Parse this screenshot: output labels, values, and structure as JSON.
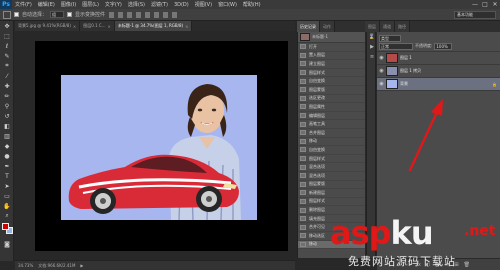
{
  "menubar": {
    "logo": "Ps",
    "items": [
      "文件(F)",
      "编辑(E)",
      "图像(I)",
      "图层(L)",
      "文字(Y)",
      "选择(S)",
      "滤镜(T)",
      "3D(D)",
      "视图(V)",
      "窗口(W)",
      "帮助(H)"
    ],
    "controls": [
      "—",
      "□",
      "✕"
    ]
  },
  "options": {
    "auto_select_label": "自动选择：",
    "auto_select_value": "组",
    "show_transform_label": "显示变换控件",
    "workspace": "基本功能"
  },
  "tabs": [
    {
      "label": "背景5.jpg @ 9.41%(RGB/8)",
      "active": false
    },
    {
      "label": "图层0.1 C...",
      "active": false
    },
    {
      "label": "未标题-1 @ 34.7%(图层 1, RGB/8)",
      "active": true
    }
  ],
  "status": {
    "zoom": "34.73%",
    "doc": "文档:966.6K/2.41M"
  },
  "panel_tabs": [
    "历史记录",
    "动作",
    "图层",
    "通道",
    "路径"
  ],
  "history": {
    "snapshot_label": "未标题-1",
    "items": [
      "打开",
      "置入图层",
      "建立图层",
      "图层样式",
      "自由变换",
      "图层蒙版",
      "选区更改",
      "图层属性",
      "编辑图层",
      "画笔工具",
      "合并图层",
      "移动",
      "自由变换",
      "图层样式",
      "混合选项",
      "混合选项",
      "图层蒙版",
      "新建图层",
      "图层样式",
      "删除图层",
      "填充图层",
      "合并可见",
      "移动选区",
      "移动"
    ],
    "selected_index": 23
  },
  "layers_controls": {
    "filter": "类型",
    "blend_mode": "正常",
    "opacity_label": "不透明度:",
    "opacity_value": "100%",
    "lock_label": "锁定:",
    "fill_label": "填充:",
    "fill_value": "100%"
  },
  "layers": [
    {
      "name": "图层 1",
      "selected": false,
      "locked": false,
      "thumb_color": "#b54a4a"
    },
    {
      "name": "图层 1 拷贝",
      "selected": false,
      "locked": false,
      "thumb_color": "#8a8fb0"
    },
    {
      "name": "背景",
      "selected": true,
      "locked": true,
      "thumb_color": "#a7b6ee"
    }
  ],
  "watermark": {
    "main_red": "asp",
    "main_white": "ku",
    "net": ".net",
    "sub": "免费网站源码下载站"
  },
  "colors": {
    "foreground": "#d00000",
    "background": "#9db3e6",
    "canvas_bg": "#a7b6ee",
    "accent": "#e01818"
  }
}
